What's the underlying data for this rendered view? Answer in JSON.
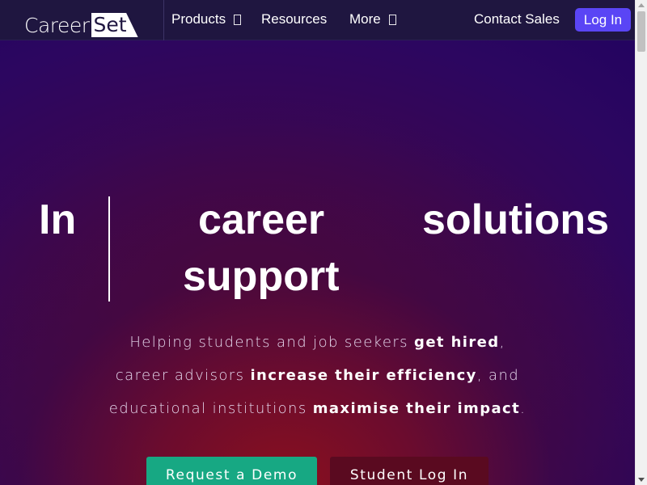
{
  "nav": {
    "logo_career": "Career",
    "logo_set": "Set",
    "products": "Products",
    "resources": "Resources",
    "more": "More",
    "contact_sales": "Contact Sales",
    "log_in": "Log In"
  },
  "hero": {
    "headline_word1": "In",
    "headline_word2": "career",
    "headline_word3": "solutions",
    "headline_word4": "support",
    "line1_pre": "Helping students and job seekers ",
    "line1_bold": "get hired",
    "line1_post": ",",
    "line2_pre": "career advisors ",
    "line2_bold": "increase their efficiency",
    "line2_post": ", and",
    "line3_pre": "educational institutions ",
    "line3_bold": "maximise their impact",
    "line3_post": ".",
    "cta_demo": "Request a Demo",
    "cta_student": "Student Log In"
  },
  "colors": {
    "nav_bg": "#1f1640",
    "login_btn": "#5a45f5",
    "demo_btn": "#17a883",
    "student_btn": "#5a0a20"
  },
  "icons": {
    "products_caret": "chevron-down-icon",
    "more_caret": "chevron-down-icon"
  }
}
